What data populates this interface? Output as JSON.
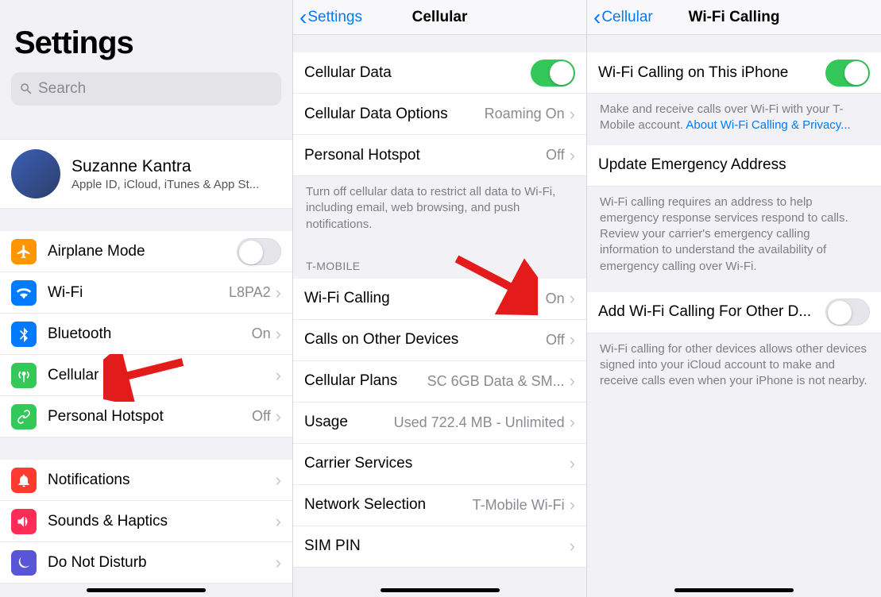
{
  "pane1": {
    "title": "Settings",
    "search_placeholder": "Search",
    "apple_id": {
      "name": "Suzanne Kantra",
      "sub": "Apple ID, iCloud, iTunes & App St..."
    },
    "group1": [
      {
        "icon": "airplane",
        "color": "orange",
        "label": "Airplane Mode",
        "toggle": "off"
      },
      {
        "icon": "wifi",
        "color": "blue",
        "label": "Wi-Fi",
        "value": "L8PA2"
      },
      {
        "icon": "bluetooth",
        "color": "blue",
        "label": "Bluetooth",
        "value": "On"
      },
      {
        "icon": "antenna",
        "color": "green",
        "label": "Cellular"
      },
      {
        "icon": "link",
        "color": "green",
        "label": "Personal Hotspot",
        "value": "Off"
      }
    ],
    "group2": [
      {
        "icon": "bell",
        "color": "red",
        "label": "Notifications"
      },
      {
        "icon": "speaker",
        "color": "dred",
        "label": "Sounds & Haptics"
      },
      {
        "icon": "moon",
        "color": "purple",
        "label": "Do Not Disturb"
      }
    ]
  },
  "pane2": {
    "back": "Settings",
    "title": "Cellular",
    "rows1": [
      {
        "label": "Cellular Data",
        "toggle": "on"
      },
      {
        "label": "Cellular Data Options",
        "value": "Roaming On"
      },
      {
        "label": "Personal Hotspot",
        "value": "Off"
      }
    ],
    "foot1": "Turn off cellular data to restrict all data to Wi-Fi, including email, web browsing, and push notifications.",
    "section2": "T-MOBILE",
    "rows2": [
      {
        "label": "Wi-Fi Calling",
        "value": "On"
      },
      {
        "label": "Calls on Other Devices",
        "value": "Off"
      },
      {
        "label": "Cellular Plans",
        "value": "SC 6GB Data & SM..."
      },
      {
        "label": "Usage",
        "value": "Used 722.4 MB - Unlimited"
      },
      {
        "label": "Carrier Services"
      },
      {
        "label": "Network Selection",
        "value": "T-Mobile Wi-Fi"
      },
      {
        "label": "SIM PIN"
      }
    ]
  },
  "pane3": {
    "back": "Cellular",
    "title": "Wi-Fi Calling",
    "r1_label": "Wi-Fi Calling on This iPhone",
    "foot1a": "Make and receive calls over Wi-Fi with your T-Mobile account. ",
    "foot1b": "About Wi-Fi Calling & Privacy...",
    "link_row": "Update Emergency Address",
    "foot2": "Wi-Fi calling requires an address to help emergency response services respond to calls. Review your carrier's emergency calling information to understand the availability of emergency calling over Wi-Fi.",
    "r3_label": "Add Wi-Fi Calling For Other D...",
    "foot3": "Wi-Fi calling for other devices allows other devices signed into your iCloud account to make and receive calls even when your iPhone is not nearby."
  }
}
